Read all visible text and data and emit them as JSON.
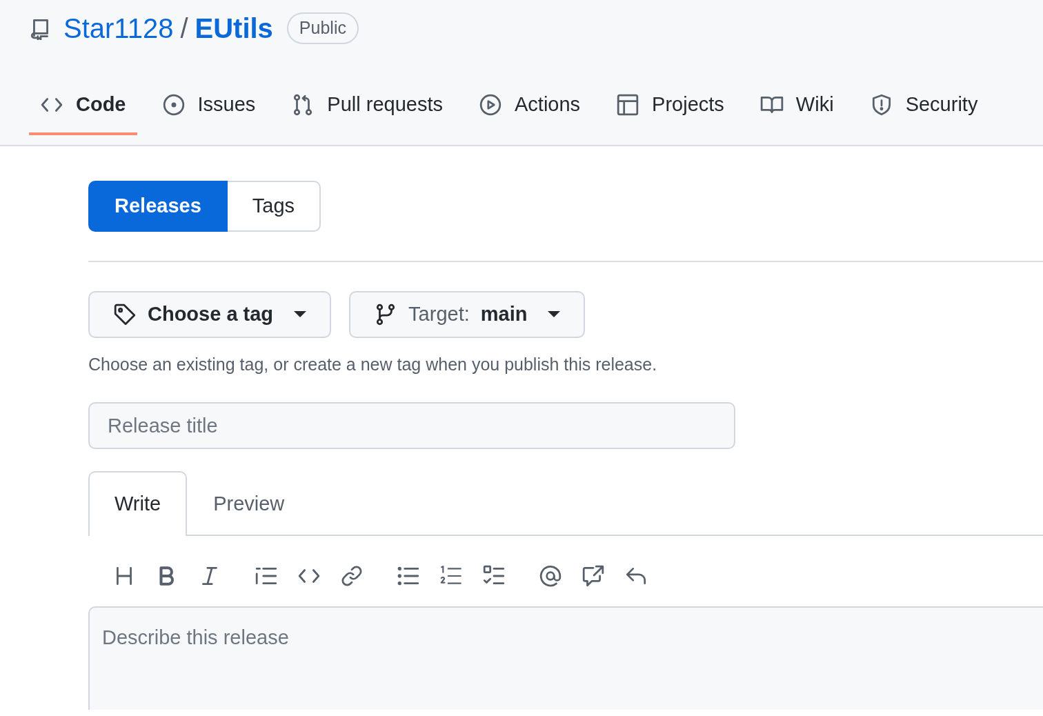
{
  "repo": {
    "owner": "Star1128",
    "separator": "/",
    "name": "EUtils",
    "visibility": "Public"
  },
  "nav_tabs": [
    {
      "label": "Code",
      "selected": true
    },
    {
      "label": "Issues",
      "selected": false
    },
    {
      "label": "Pull requests",
      "selected": false
    },
    {
      "label": "Actions",
      "selected": false
    },
    {
      "label": "Projects",
      "selected": false
    },
    {
      "label": "Wiki",
      "selected": false
    },
    {
      "label": "Security",
      "selected": false
    }
  ],
  "release_tabs": [
    {
      "label": "Releases",
      "selected": true
    },
    {
      "label": "Tags",
      "selected": false
    }
  ],
  "tag_button": {
    "label": "Choose a tag"
  },
  "target_button": {
    "label": "Target:",
    "value": "main"
  },
  "hint": "Choose an existing tag, or create a new tag when you publish this release.",
  "title_field": {
    "placeholder": "Release title"
  },
  "editor_tabs": [
    {
      "label": "Write",
      "selected": true
    },
    {
      "label": "Preview",
      "selected": false
    }
  ],
  "description_field": {
    "placeholder": "Describe this release"
  }
}
